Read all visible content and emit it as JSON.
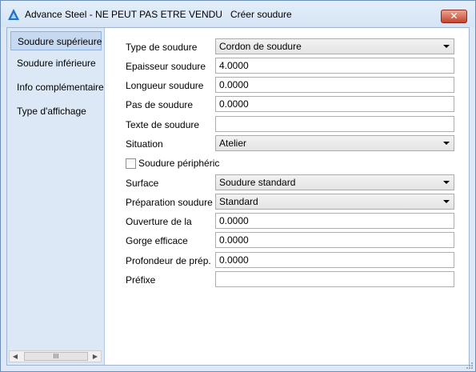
{
  "window": {
    "title": "Advance Steel - NE PEUT PAS ETRE VENDU   Créer soudure",
    "close_label": "✕"
  },
  "sidebar": {
    "items": [
      {
        "label": "Soudure supérieure",
        "active": true
      },
      {
        "label": "Soudure inférieure",
        "active": false
      },
      {
        "label": "Info complémentaire",
        "active": false
      },
      {
        "label": "Type d'affichage",
        "active": false
      }
    ],
    "scroll_left": "◀",
    "scroll_right": "▶",
    "scroll_thumb": "III"
  },
  "form": {
    "type_soudure": {
      "label": "Type de soudure",
      "value": "Cordon de soudure"
    },
    "epaisseur": {
      "label": "Epaisseur soudure",
      "value": "4.0000"
    },
    "longueur": {
      "label": "Longueur soudure",
      "value": "0.0000"
    },
    "pas": {
      "label": "Pas de soudure",
      "value": "0.0000"
    },
    "texte": {
      "label": "Texte de soudure",
      "value": ""
    },
    "situation": {
      "label": "Situation",
      "value": "Atelier"
    },
    "peripherique": {
      "label": "Soudure périphéric",
      "checked": false
    },
    "surface": {
      "label": "Surface",
      "value": "Soudure standard"
    },
    "preparation": {
      "label": "Préparation soudure",
      "value": "Standard"
    },
    "ouverture": {
      "label": "Ouverture de la",
      "value": "0.0000"
    },
    "gorge": {
      "label": "Gorge efficace",
      "value": "0.0000"
    },
    "profondeur": {
      "label": "Profondeur de prép.",
      "value": "0.0000"
    },
    "prefixe": {
      "label": "Préfixe",
      "value": ""
    }
  },
  "colors": {
    "accent": "#c6d9f1",
    "close_button": "#c7432b",
    "sidebar_bg": "#dce8f6"
  }
}
